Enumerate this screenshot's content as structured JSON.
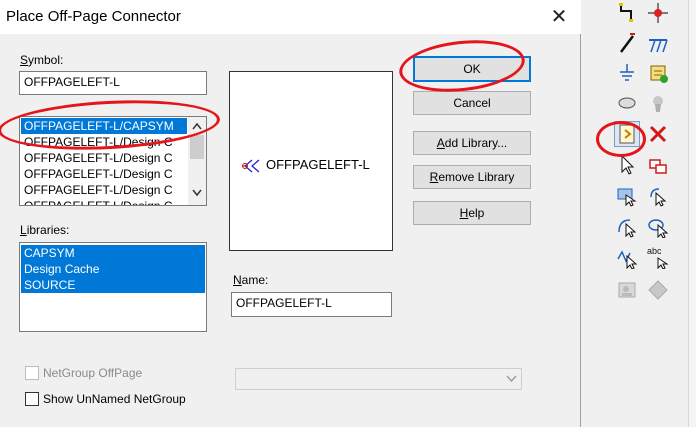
{
  "dialog": {
    "title": "Place Off-Page Connector",
    "close_glyph": "✕",
    "symbol": {
      "label_u": "S",
      "label_rest": "ymbol:",
      "value": "OFFPAGELEFT-L"
    },
    "symbol_list": {
      "items": [
        "OFFPAGELEFT-L/CAPSYM",
        "OFFPAGELEFT-L/Design C",
        "OFFPAGELEFT-L/Design C",
        "OFFPAGELEFT-L/Design C",
        "OFFPAGELEFT-L/Design C",
        "OFFPAGELEFT-L/Design C"
      ],
      "selected_index": 0
    },
    "libraries": {
      "label_u": "L",
      "label_rest": "ibraries:",
      "items": [
        "CAPSYM",
        "Design Cache",
        "SOURCE"
      ]
    },
    "preview": {
      "connector_text": "OFFPAGELEFT-L"
    },
    "name": {
      "label_u": "N",
      "label_rest": "ame:",
      "value": "OFFPAGELEFT-L"
    },
    "buttons": {
      "ok": "OK",
      "cancel": "Cancel",
      "add_library_u": "A",
      "add_library_rest": "dd Library...",
      "remove_library_u": "R",
      "remove_library_rest": "emove Library",
      "help_u": "H",
      "help_rest": "elp"
    },
    "netgroup_offpage": {
      "label": "NetGroup OffPage",
      "checked": false,
      "enabled": false
    },
    "show_unnamed": {
      "label": "Show UnNamed NetGroup",
      "checked": false
    },
    "netgroup_combo": {
      "value": "",
      "enabled": false
    }
  },
  "toolbar": {
    "icons": [
      "wire-icon",
      "junction-icon",
      "bus-icon",
      "bus-entry-icon",
      "ground-icon",
      "place-part-icon",
      "net-alias-icon",
      "power-icon",
      "off-page-connector-icon",
      "no-connect-icon",
      "pointer-icon",
      "hierarchical-block-icon",
      "hierarchical-port-icon",
      "hierarchical-pin-icon",
      "arc-icon",
      "ellipse-icon",
      "polyline-icon",
      "text-icon",
      "picture-icon",
      "bookmark-icon"
    ],
    "text_icon_label": "abc"
  },
  "annotation_color": "#e5151b",
  "selection_color": "#0078d7"
}
